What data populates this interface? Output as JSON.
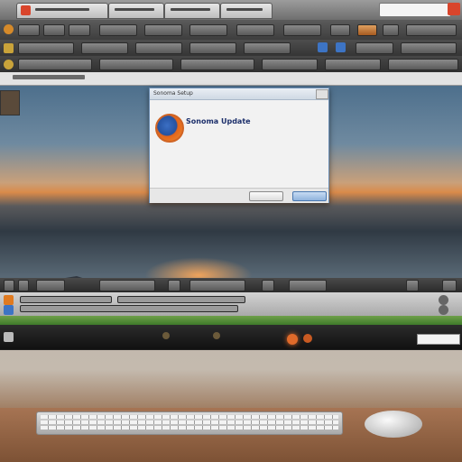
{
  "browser": {
    "tabs": [
      {
        "label": ""
      },
      {
        "label": ""
      },
      {
        "label": ""
      },
      {
        "label": ""
      }
    ]
  },
  "dialog": {
    "title": "Sonoma Setup",
    "heading": "Sonoma Update",
    "subtitle_lines": [
      "",
      ""
    ],
    "body_lines": [
      "",
      "",
      ""
    ],
    "footer_label": "",
    "cancel_label": "",
    "ok_label": ""
  },
  "taskbar": {
    "status_text": "",
    "search_placeholder": ""
  },
  "colors": {
    "dialog_heading": "#1c2f6b",
    "accent_blue": "#4a78b0",
    "brand_orange": "#e2651c",
    "taskbar_green": "#3f7a2a"
  },
  "icons": [
    "browser-tab-icon",
    "app-logo-icon",
    "close-icon",
    "settings-icon"
  ]
}
